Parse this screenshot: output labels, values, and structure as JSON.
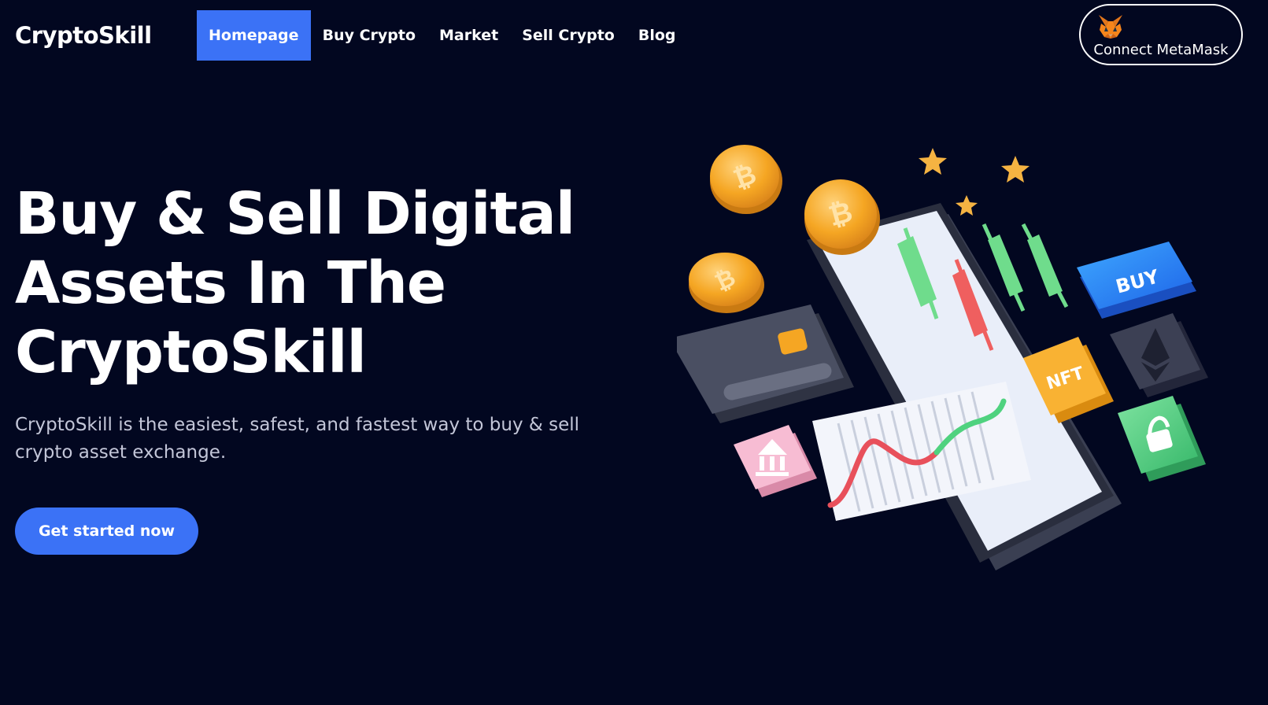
{
  "header": {
    "logo": "CryptoSkill",
    "nav": [
      {
        "label": "Homepage",
        "active": true
      },
      {
        "label": "Buy Crypto",
        "active": false
      },
      {
        "label": "Market",
        "active": false
      },
      {
        "label": "Sell Crypto",
        "active": false
      },
      {
        "label": "Blog",
        "active": false
      }
    ],
    "connect_button": {
      "label": "Connect MetaMask",
      "icon": "metamask-fox-icon"
    }
  },
  "hero": {
    "title": "Buy & Sell Digital Assets In The CryptoSkill",
    "subtitle": "CryptoSkill is the easiest, safest, and fastest way to buy & sell crypto asset exchange.",
    "cta_label": "Get started now"
  },
  "illustration": {
    "buy_tag": "BUY",
    "nft_tag": "NFT",
    "icons": [
      "bitcoin-coin-icon",
      "star-icon",
      "credit-card-icon",
      "bank-icon",
      "ethereum-icon",
      "lock-icon",
      "candlestick-icon"
    ]
  },
  "colors": {
    "background": "#020720",
    "accent": "#3b72f6",
    "text": "#ffffff",
    "muted_text": "#c3c6d8"
  }
}
